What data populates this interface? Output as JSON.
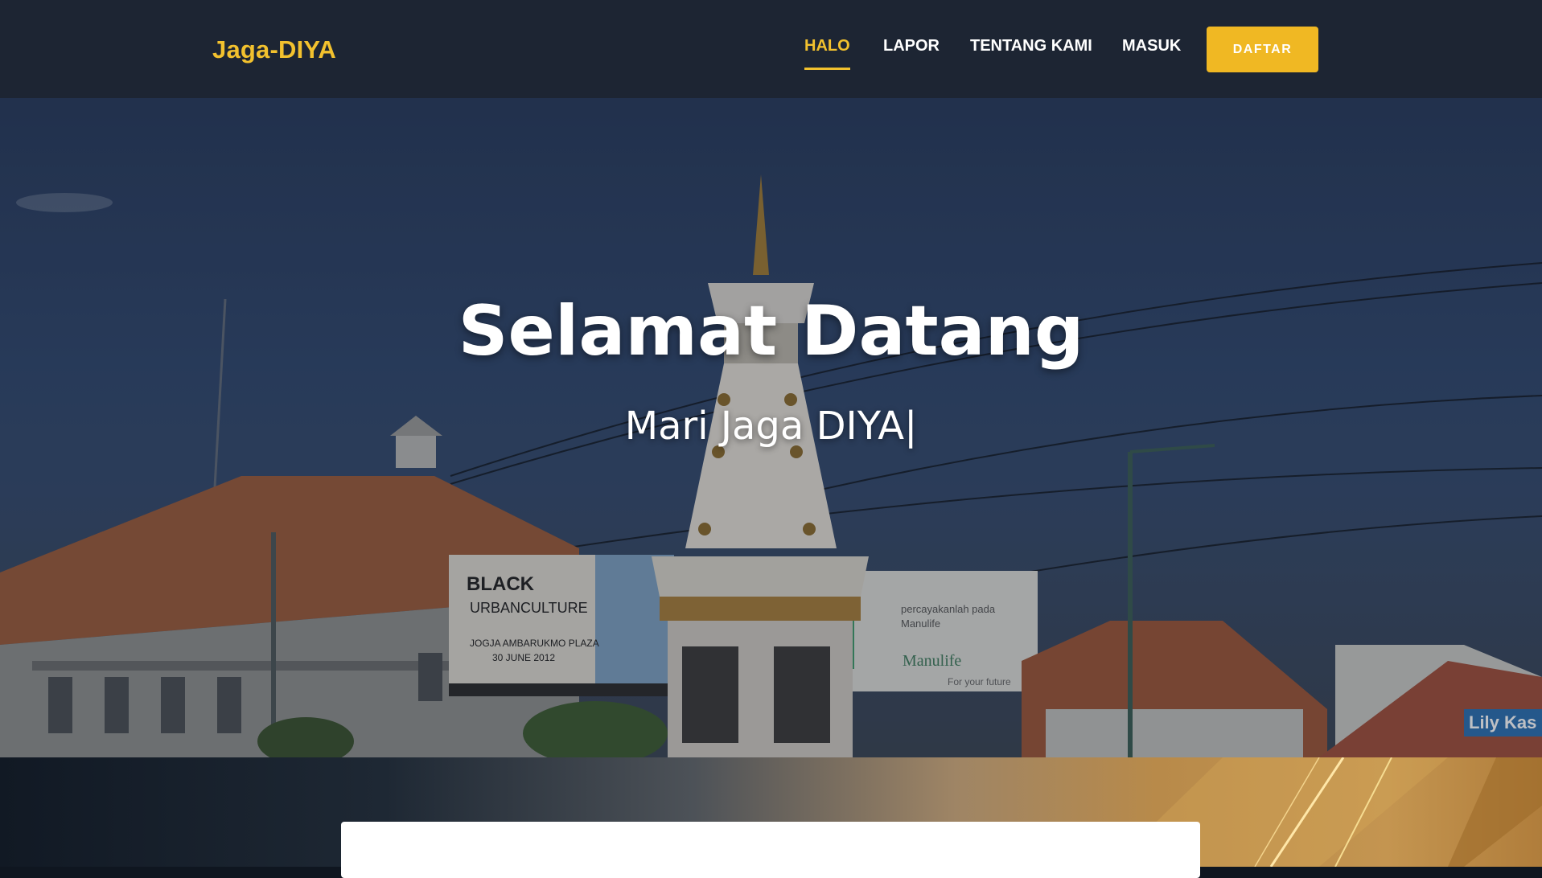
{
  "header": {
    "brand": "Jaga-DIYA",
    "nav": [
      {
        "label": "HALO",
        "active": true
      },
      {
        "label": "LAPOR",
        "active": false
      },
      {
        "label": "TENTANG KAMI",
        "active": false
      },
      {
        "label": "MASUK",
        "active": false
      }
    ],
    "cta_label": "DAFTAR"
  },
  "hero": {
    "title": "Selamat Datang",
    "subtitle": "Mari Jaga DIYA",
    "cursor": "|"
  },
  "colors": {
    "accent": "#f2c12e",
    "header_bg": "#1d2533",
    "button_bg": "#f0b823"
  }
}
